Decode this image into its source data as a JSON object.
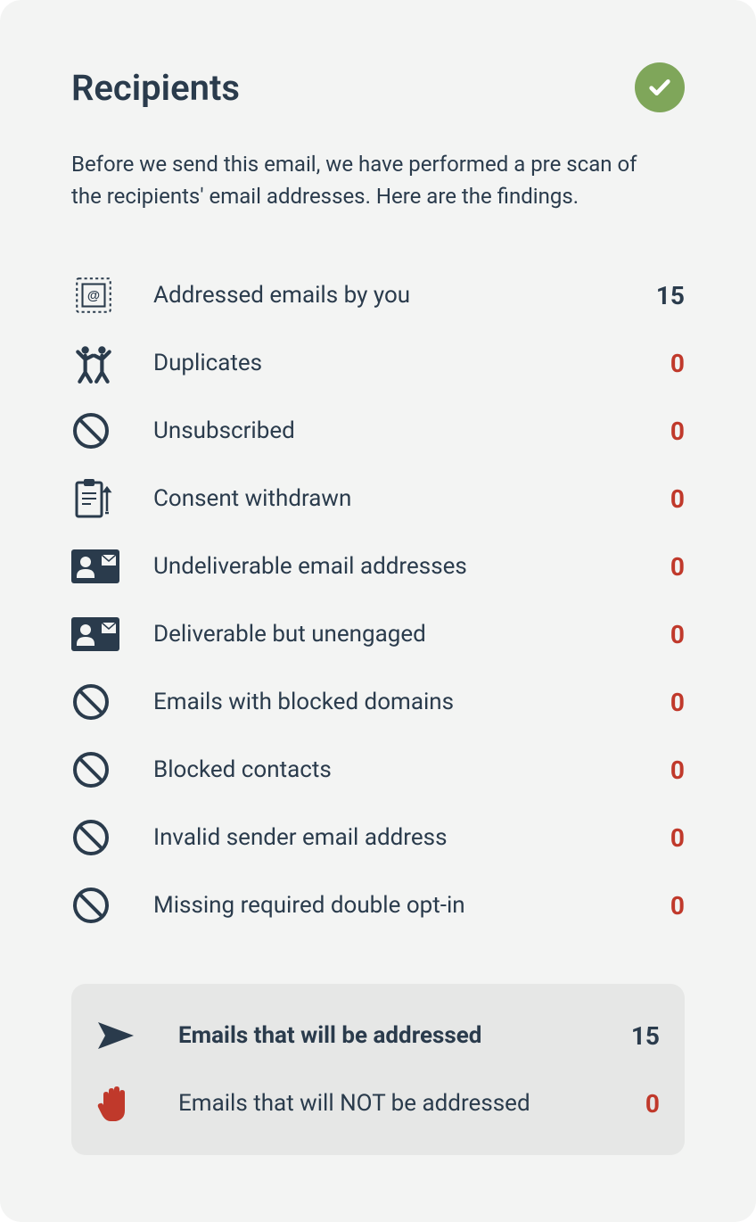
{
  "title": "Recipients",
  "description": "Before we send this email, we have performed a pre scan of the recipients' email addresses. Here are the findings.",
  "stats": {
    "addressed": {
      "label": "Addressed emails by you",
      "value": "15"
    },
    "duplicates": {
      "label": "Duplicates",
      "value": "0"
    },
    "unsubscribed": {
      "label": "Unsubscribed",
      "value": "0"
    },
    "consent_withdrawn": {
      "label": "Consent withdrawn",
      "value": "0"
    },
    "undeliverable": {
      "label": "Undeliverable email addresses",
      "value": "0"
    },
    "unengaged": {
      "label": "Deliverable but unengaged",
      "value": "0"
    },
    "blocked_domains": {
      "label": "Emails with blocked domains",
      "value": "0"
    },
    "blocked_contacts": {
      "label": "Blocked contacts",
      "value": "0"
    },
    "invalid_sender": {
      "label": "Invalid sender email address",
      "value": "0"
    },
    "missing_optin": {
      "label": "Missing required double opt-in",
      "value": "0"
    }
  },
  "summary": {
    "will_address": {
      "label": "Emails that will be addressed",
      "value": "15"
    },
    "will_not_address": {
      "label": "Emails that will NOT be addressed",
      "value": "0"
    }
  }
}
